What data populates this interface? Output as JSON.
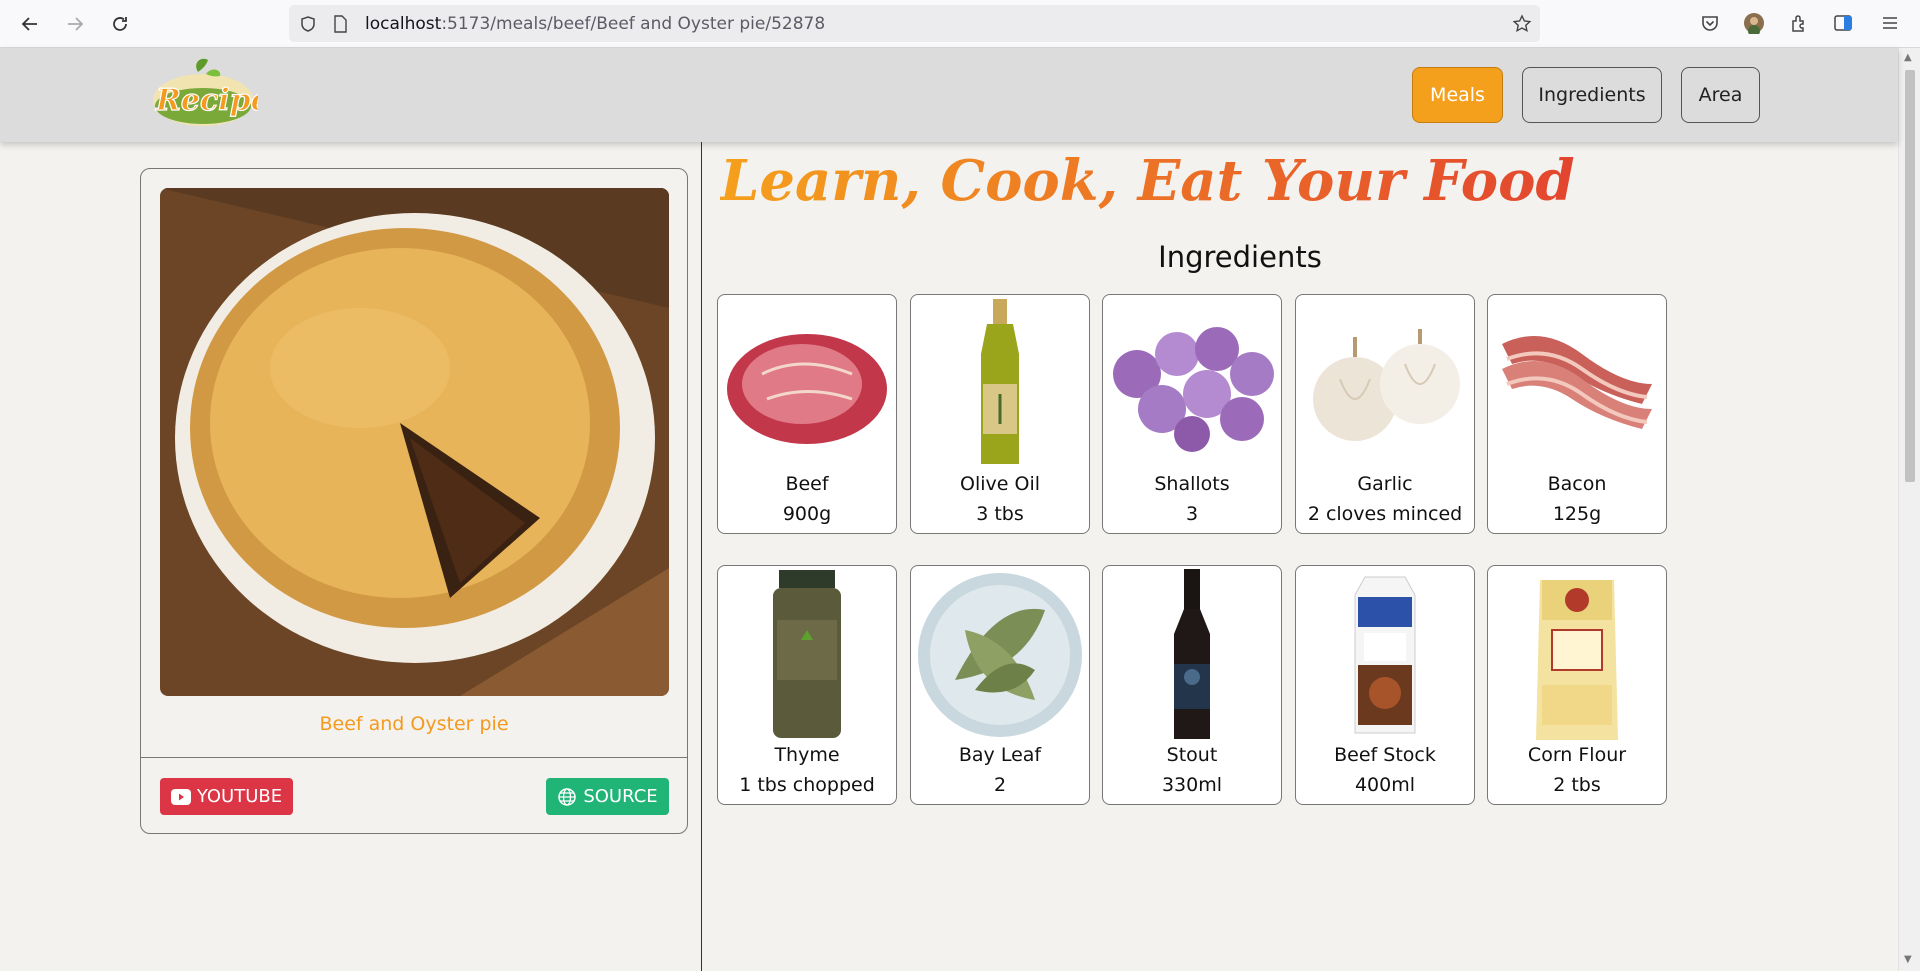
{
  "browser": {
    "url_host": "localhost",
    "url_path": ":5173/meals/beef/Beef and Oyster pie/52878"
  },
  "nav": {
    "logo_text": "Recipe",
    "links": [
      {
        "label": "Meals",
        "active": true
      },
      {
        "label": "Ingredients",
        "active": false
      },
      {
        "label": "Area",
        "active": false
      }
    ]
  },
  "meal": {
    "name": "Beef and Oyster pie",
    "youtube_label": "YOUTUBE",
    "source_label": "SOURCE"
  },
  "hero": {
    "title": "Learn, Cook, Eat Your Food"
  },
  "ingredients": {
    "heading": "Ingredients",
    "items": [
      {
        "name": "Beef",
        "measure": "900g",
        "icon": "beef-image"
      },
      {
        "name": "Olive Oil",
        "measure": "3 tbs",
        "icon": "olive-oil-image"
      },
      {
        "name": "Shallots",
        "measure": "3",
        "icon": "shallots-image"
      },
      {
        "name": "Garlic",
        "measure": "2 cloves minced",
        "icon": "garlic-image"
      },
      {
        "name": "Bacon",
        "measure": "125g",
        "icon": "bacon-image"
      },
      {
        "name": "Thyme",
        "measure": "1 tbs chopped",
        "icon": "thyme-image"
      },
      {
        "name": "Bay Leaf",
        "measure": "2",
        "icon": "bay-leaf-image"
      },
      {
        "name": "Stout",
        "measure": "330ml",
        "icon": "stout-image"
      },
      {
        "name": "Beef Stock",
        "measure": "400ml",
        "icon": "beef-stock-image"
      },
      {
        "name": "Corn Flour",
        "measure": "2 tbs",
        "icon": "corn-flour-image"
      }
    ]
  },
  "colors": {
    "accent": "#f5a01c",
    "youtube": "#dc3545",
    "source": "#20b576",
    "title_gradient_start": "#f5a01c",
    "title_gradient_end": "#e3452f"
  }
}
